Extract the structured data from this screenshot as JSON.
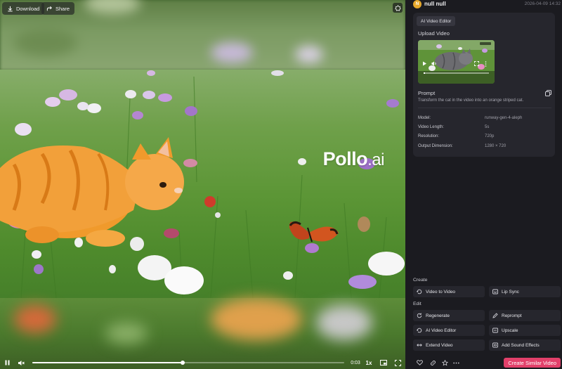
{
  "player": {
    "download_label": "Download",
    "share_label": "Share",
    "time": "0:03",
    "speed": "1x",
    "progress": 0.483,
    "watermark_brand": "Pollo",
    "watermark_suffix": ".ai"
  },
  "user": {
    "avatar_initial": "N",
    "name": "null null",
    "date": "2026-04-09 14:32"
  },
  "card": {
    "tool_chip": "AI Video Editor",
    "upload_label": "Upload Video",
    "prompt_label": "Prompt",
    "prompt_text": "Transform the cat in the video into an orange striped cat.",
    "meta": [
      {
        "key": "Model:",
        "value": "runway-gen-4-aleph"
      },
      {
        "key": "Video Length:",
        "value": "5s"
      },
      {
        "key": "Resolution:",
        "value": "720p"
      },
      {
        "key": "Output Dimension:",
        "value": "1280 × 720"
      }
    ]
  },
  "create_section": {
    "label": "Create",
    "actions": [
      {
        "label": "Video to Video",
        "icon": "video-to-video-icon"
      },
      {
        "label": "Lip Sync",
        "icon": "lip-sync-icon"
      }
    ]
  },
  "edit_section": {
    "label": "Edit",
    "actions": [
      {
        "label": "Regenerate",
        "icon": "regenerate-icon"
      },
      {
        "label": "Reprompt",
        "icon": "pencil-icon"
      },
      {
        "label": "AI Video Editor",
        "icon": "editor-icon"
      },
      {
        "label": "Upscale",
        "icon": "upscale-icon"
      },
      {
        "label": "Extend Video",
        "icon": "extend-icon"
      },
      {
        "label": "Add Sound Effects",
        "icon": "sound-icon"
      }
    ]
  },
  "footer": {
    "create_similar_label": "Create Similar Video"
  },
  "colors": {
    "accent": "#e2406a",
    "panel_bg": "#1b1b20",
    "card_bg": "#26262d"
  }
}
